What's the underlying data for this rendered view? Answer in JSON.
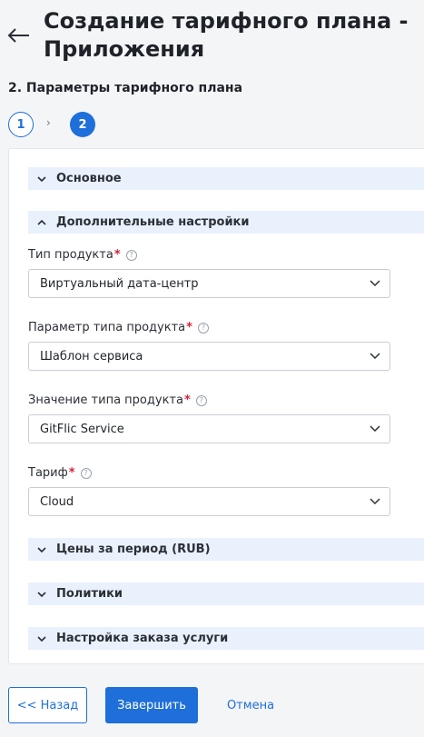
{
  "header": {
    "title_line1": "Создание тарифного плана -",
    "title_line2": "Приложения",
    "back_icon": "arrow-left-icon"
  },
  "section": {
    "title": "2. Параметры тарифного плана"
  },
  "stepper": {
    "steps": [
      {
        "label": "1",
        "state": "done"
      },
      {
        "label": "2",
        "state": "active"
      }
    ],
    "separator": "›"
  },
  "accordions": {
    "basic": {
      "label": "Основное",
      "expanded": false
    },
    "additional": {
      "label": "Дополнительные настройки",
      "expanded": true
    },
    "prices": {
      "label": "Цены за период (RUB)",
      "expanded": false
    },
    "policies": {
      "label": "Политики",
      "expanded": false
    },
    "order": {
      "label": "Настройка заказа услуги",
      "expanded": false
    }
  },
  "fields": {
    "product_type": {
      "label": "Тип продукта",
      "required_mark": "*",
      "value": "Виртуальный дата-центр"
    },
    "product_type_param": {
      "label": "Параметр типа продукта",
      "required_mark": "*",
      "value": "Шаблон сервиса"
    },
    "product_type_value": {
      "label": "Значение типа продукта",
      "required_mark": "*",
      "value": "GitFlic Service"
    },
    "tariff": {
      "label": "Тариф",
      "required_mark": "*",
      "value": "Cloud"
    }
  },
  "help_glyph": "?",
  "buttons": {
    "back": "<< Назад",
    "finish": "Завершить",
    "cancel": "Отмена"
  },
  "colors": {
    "accent": "#1e6fd9",
    "accordion_bg": "#e9f1fd",
    "required": "#d0243a",
    "page_bg": "#f4f5f7"
  }
}
